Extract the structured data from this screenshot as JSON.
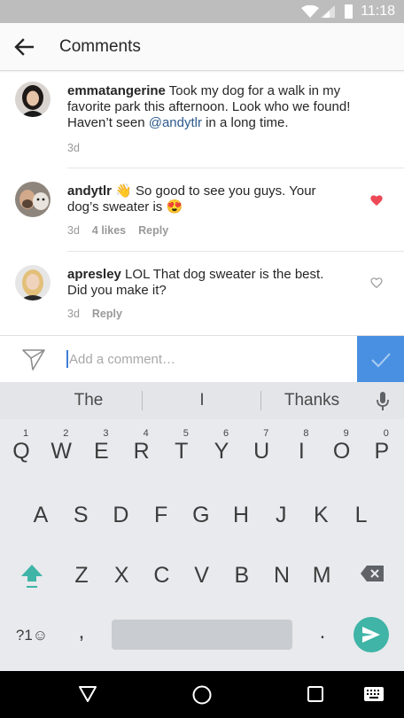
{
  "status_bar": {
    "time": "11:18"
  },
  "header": {
    "title": "Comments",
    "back_icon": "arrow-left-icon"
  },
  "comments": [
    {
      "username": "emmatangerine",
      "text_before": " Took my dog for a walk in my favorite park this afternoon. Look who we found! Haven’t seen ",
      "mention": "@andytlr",
      "text_after": " in a long time.",
      "time": "3d",
      "liked": false
    },
    {
      "username": "andytlr",
      "emoji1": "👋",
      "text": " So good to see you guys. Your dog’s sweater is ",
      "emoji2": "😍",
      "time": "3d",
      "likes": "4 likes",
      "reply": "Reply",
      "liked": true,
      "heart_color": "#ed4956"
    },
    {
      "username": "apresley",
      "text": " LOL That dog sweater is the best. Did you make it?",
      "time": "3d",
      "reply": "Reply",
      "liked": false
    }
  ],
  "composer": {
    "placeholder": "Add a comment…",
    "post_color": "#4a90e2"
  },
  "keyboard": {
    "suggestions": [
      "The",
      "I",
      "Thanks"
    ],
    "row1": [
      {
        "k": "Q",
        "n": "1"
      },
      {
        "k": "W",
        "n": "2"
      },
      {
        "k": "E",
        "n": "3"
      },
      {
        "k": "R",
        "n": "4"
      },
      {
        "k": "T",
        "n": "5"
      },
      {
        "k": "Y",
        "n": "6"
      },
      {
        "k": "U",
        "n": "7"
      },
      {
        "k": "I",
        "n": "8"
      },
      {
        "k": "O",
        "n": "9"
      },
      {
        "k": "P",
        "n": "0"
      }
    ],
    "row2": [
      "A",
      "S",
      "D",
      "F",
      "G",
      "H",
      "J",
      "K",
      "L"
    ],
    "row3": [
      "Z",
      "X",
      "C",
      "V",
      "B",
      "N",
      "M"
    ],
    "symbols_key": "?1☺",
    "comma_key": ",",
    "period_key": ".",
    "accent_color": "#3fb4a7"
  }
}
